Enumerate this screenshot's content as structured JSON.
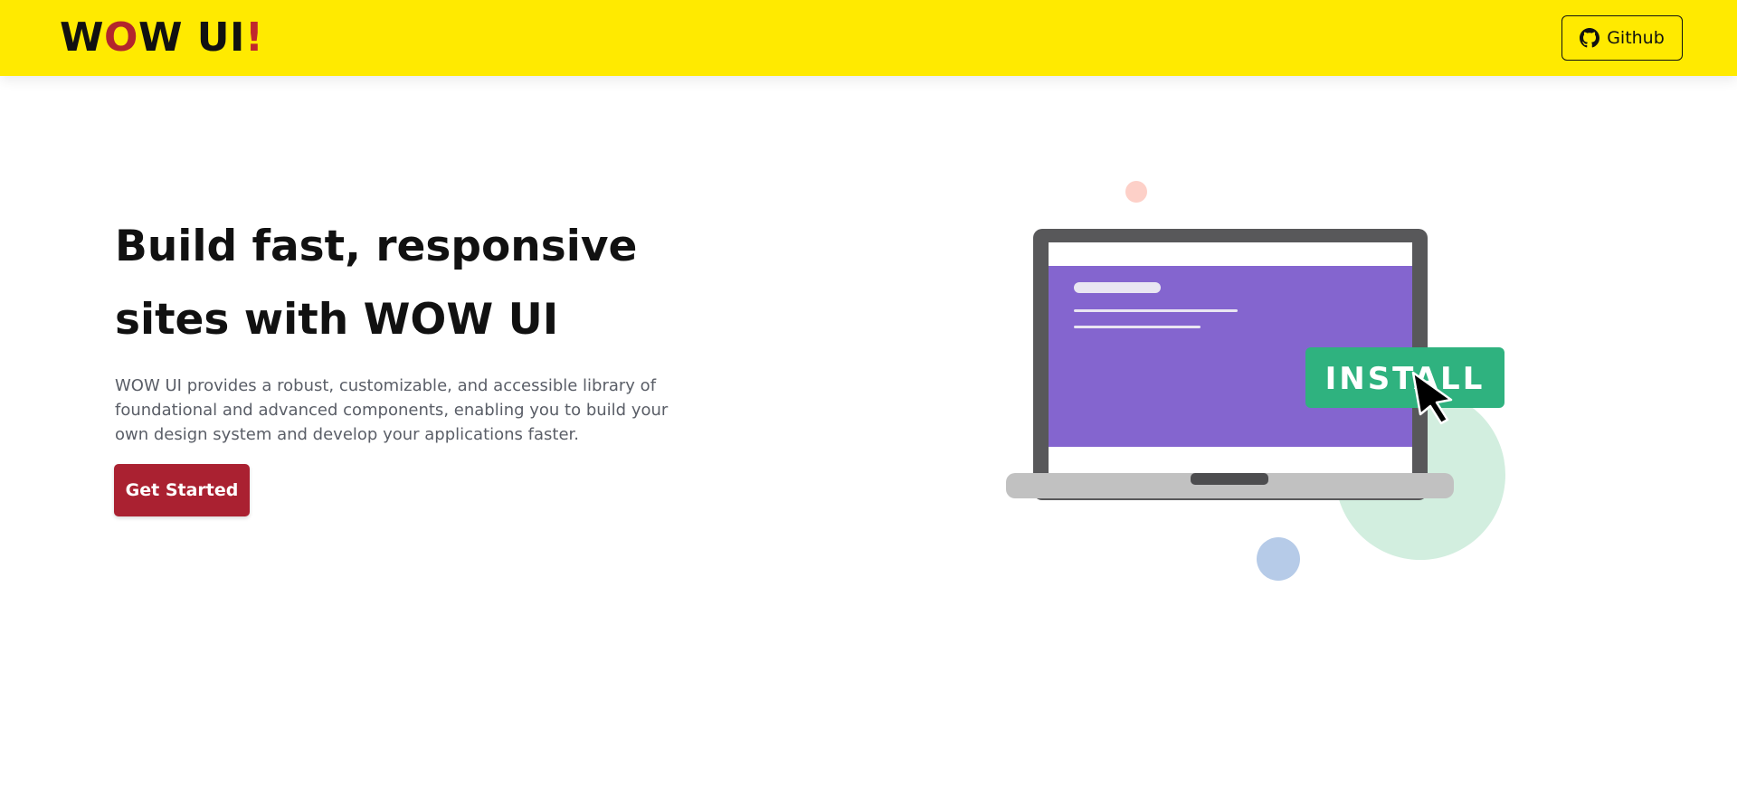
{
  "nav": {
    "brand": {
      "w1": "W",
      "o": "O",
      "w2": "W UI",
      "bang": "!"
    },
    "github_label": "Github"
  },
  "hero": {
    "title": "Build fast, responsive sites with WOW UI",
    "description": "WOW UI provides a robust, customizable, and accessible library of foundational and advanced components, enabling you to build your own design system and develop your applications faster.",
    "cta_label": "Get Started"
  },
  "illustration": {
    "button_label": "INSTALL"
  },
  "colors": {
    "navbar": "#ffea00",
    "brand_accent": "#b3262c",
    "cta": "#aa2131",
    "screen": "#8465cf",
    "install": "#2fb27f",
    "text_muted": "#5a5e67"
  },
  "icons": {
    "github": "github-icon",
    "cursor": "mouse-pointer-icon"
  }
}
